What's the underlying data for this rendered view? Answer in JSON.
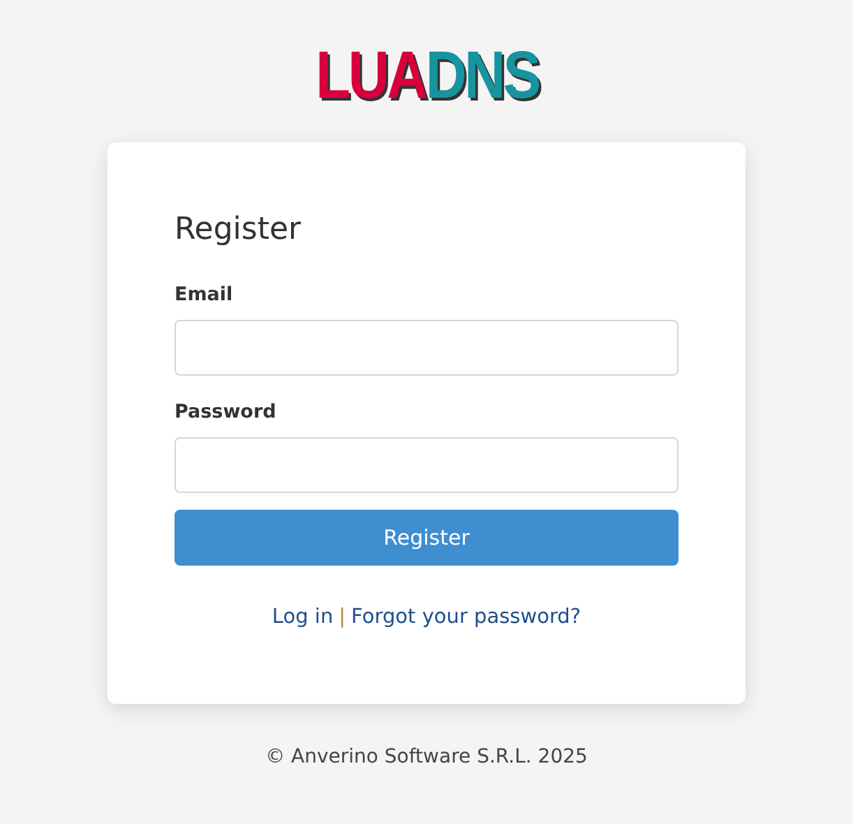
{
  "logo": {
    "parts": [
      {
        "text": "LUA",
        "color": "#d8003c"
      },
      {
        "text": "DNS",
        "color": "#16949f"
      }
    ]
  },
  "form": {
    "title": "Register",
    "fields": [
      {
        "label": "Email"
      },
      {
        "label": "Password"
      }
    ],
    "submit": "Register",
    "links": [
      "Log in",
      "Forgot your password?"
    ],
    "separator": "|"
  },
  "footer": "© Anverino Software S.R.L. 2025"
}
